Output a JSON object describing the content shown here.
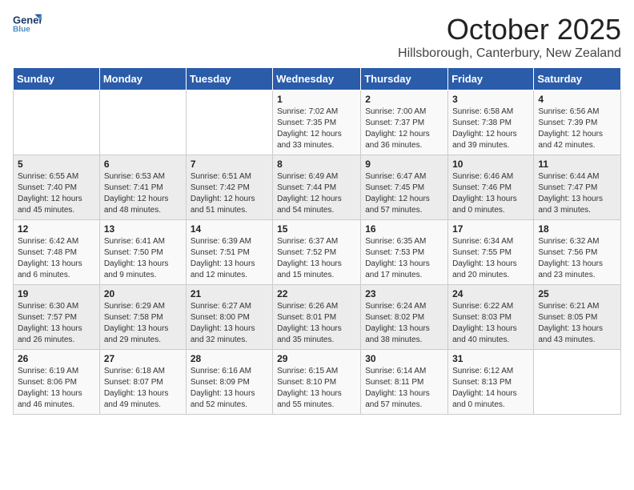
{
  "logo": {
    "line1": "General",
    "line2": "Blue"
  },
  "title": "October 2025",
  "subtitle": "Hillsborough, Canterbury, New Zealand",
  "days_of_week": [
    "Sunday",
    "Monday",
    "Tuesday",
    "Wednesday",
    "Thursday",
    "Friday",
    "Saturday"
  ],
  "weeks": [
    [
      {
        "day": "",
        "sunrise": "",
        "sunset": "",
        "daylight": ""
      },
      {
        "day": "",
        "sunrise": "",
        "sunset": "",
        "daylight": ""
      },
      {
        "day": "",
        "sunrise": "",
        "sunset": "",
        "daylight": ""
      },
      {
        "day": "1",
        "sunrise": "Sunrise: 7:02 AM",
        "sunset": "Sunset: 7:35 PM",
        "daylight": "Daylight: 12 hours and 33 minutes."
      },
      {
        "day": "2",
        "sunrise": "Sunrise: 7:00 AM",
        "sunset": "Sunset: 7:37 PM",
        "daylight": "Daylight: 12 hours and 36 minutes."
      },
      {
        "day": "3",
        "sunrise": "Sunrise: 6:58 AM",
        "sunset": "Sunset: 7:38 PM",
        "daylight": "Daylight: 12 hours and 39 minutes."
      },
      {
        "day": "4",
        "sunrise": "Sunrise: 6:56 AM",
        "sunset": "Sunset: 7:39 PM",
        "daylight": "Daylight: 12 hours and 42 minutes."
      }
    ],
    [
      {
        "day": "5",
        "sunrise": "Sunrise: 6:55 AM",
        "sunset": "Sunset: 7:40 PM",
        "daylight": "Daylight: 12 hours and 45 minutes."
      },
      {
        "day": "6",
        "sunrise": "Sunrise: 6:53 AM",
        "sunset": "Sunset: 7:41 PM",
        "daylight": "Daylight: 12 hours and 48 minutes."
      },
      {
        "day": "7",
        "sunrise": "Sunrise: 6:51 AM",
        "sunset": "Sunset: 7:42 PM",
        "daylight": "Daylight: 12 hours and 51 minutes."
      },
      {
        "day": "8",
        "sunrise": "Sunrise: 6:49 AM",
        "sunset": "Sunset: 7:44 PM",
        "daylight": "Daylight: 12 hours and 54 minutes."
      },
      {
        "day": "9",
        "sunrise": "Sunrise: 6:47 AM",
        "sunset": "Sunset: 7:45 PM",
        "daylight": "Daylight: 12 hours and 57 minutes."
      },
      {
        "day": "10",
        "sunrise": "Sunrise: 6:46 AM",
        "sunset": "Sunset: 7:46 PM",
        "daylight": "Daylight: 13 hours and 0 minutes."
      },
      {
        "day": "11",
        "sunrise": "Sunrise: 6:44 AM",
        "sunset": "Sunset: 7:47 PM",
        "daylight": "Daylight: 13 hours and 3 minutes."
      }
    ],
    [
      {
        "day": "12",
        "sunrise": "Sunrise: 6:42 AM",
        "sunset": "Sunset: 7:48 PM",
        "daylight": "Daylight: 13 hours and 6 minutes."
      },
      {
        "day": "13",
        "sunrise": "Sunrise: 6:41 AM",
        "sunset": "Sunset: 7:50 PM",
        "daylight": "Daylight: 13 hours and 9 minutes."
      },
      {
        "day": "14",
        "sunrise": "Sunrise: 6:39 AM",
        "sunset": "Sunset: 7:51 PM",
        "daylight": "Daylight: 13 hours and 12 minutes."
      },
      {
        "day": "15",
        "sunrise": "Sunrise: 6:37 AM",
        "sunset": "Sunset: 7:52 PM",
        "daylight": "Daylight: 13 hours and 15 minutes."
      },
      {
        "day": "16",
        "sunrise": "Sunrise: 6:35 AM",
        "sunset": "Sunset: 7:53 PM",
        "daylight": "Daylight: 13 hours and 17 minutes."
      },
      {
        "day": "17",
        "sunrise": "Sunrise: 6:34 AM",
        "sunset": "Sunset: 7:55 PM",
        "daylight": "Daylight: 13 hours and 20 minutes."
      },
      {
        "day": "18",
        "sunrise": "Sunrise: 6:32 AM",
        "sunset": "Sunset: 7:56 PM",
        "daylight": "Daylight: 13 hours and 23 minutes."
      }
    ],
    [
      {
        "day": "19",
        "sunrise": "Sunrise: 6:30 AM",
        "sunset": "Sunset: 7:57 PM",
        "daylight": "Daylight: 13 hours and 26 minutes."
      },
      {
        "day": "20",
        "sunrise": "Sunrise: 6:29 AM",
        "sunset": "Sunset: 7:58 PM",
        "daylight": "Daylight: 13 hours and 29 minutes."
      },
      {
        "day": "21",
        "sunrise": "Sunrise: 6:27 AM",
        "sunset": "Sunset: 8:00 PM",
        "daylight": "Daylight: 13 hours and 32 minutes."
      },
      {
        "day": "22",
        "sunrise": "Sunrise: 6:26 AM",
        "sunset": "Sunset: 8:01 PM",
        "daylight": "Daylight: 13 hours and 35 minutes."
      },
      {
        "day": "23",
        "sunrise": "Sunrise: 6:24 AM",
        "sunset": "Sunset: 8:02 PM",
        "daylight": "Daylight: 13 hours and 38 minutes."
      },
      {
        "day": "24",
        "sunrise": "Sunrise: 6:22 AM",
        "sunset": "Sunset: 8:03 PM",
        "daylight": "Daylight: 13 hours and 40 minutes."
      },
      {
        "day": "25",
        "sunrise": "Sunrise: 6:21 AM",
        "sunset": "Sunset: 8:05 PM",
        "daylight": "Daylight: 13 hours and 43 minutes."
      }
    ],
    [
      {
        "day": "26",
        "sunrise": "Sunrise: 6:19 AM",
        "sunset": "Sunset: 8:06 PM",
        "daylight": "Daylight: 13 hours and 46 minutes."
      },
      {
        "day": "27",
        "sunrise": "Sunrise: 6:18 AM",
        "sunset": "Sunset: 8:07 PM",
        "daylight": "Daylight: 13 hours and 49 minutes."
      },
      {
        "day": "28",
        "sunrise": "Sunrise: 6:16 AM",
        "sunset": "Sunset: 8:09 PM",
        "daylight": "Daylight: 13 hours and 52 minutes."
      },
      {
        "day": "29",
        "sunrise": "Sunrise: 6:15 AM",
        "sunset": "Sunset: 8:10 PM",
        "daylight": "Daylight: 13 hours and 55 minutes."
      },
      {
        "day": "30",
        "sunrise": "Sunrise: 6:14 AM",
        "sunset": "Sunset: 8:11 PM",
        "daylight": "Daylight: 13 hours and 57 minutes."
      },
      {
        "day": "31",
        "sunrise": "Sunrise: 6:12 AM",
        "sunset": "Sunset: 8:13 PM",
        "daylight": "Daylight: 14 hours and 0 minutes."
      },
      {
        "day": "",
        "sunrise": "",
        "sunset": "",
        "daylight": ""
      }
    ]
  ]
}
